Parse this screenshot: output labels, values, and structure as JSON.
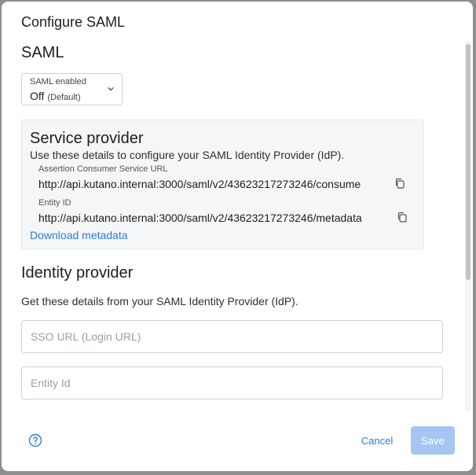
{
  "dialog": {
    "title": "Configure SAML"
  },
  "saml": {
    "section_title": "SAML",
    "enabled_label": "SAML enabled",
    "enabled_value": "Off",
    "enabled_hint": "(Default)"
  },
  "service_provider": {
    "title": "Service provider",
    "description": "Use these details to configure your SAML Identity Provider (IdP).",
    "acs_label": "Assertion Consumer Service URL",
    "acs_value": "http://api.kutano.internal:3000/saml/v2/43623217273246/consume",
    "entity_label": "Entity ID",
    "entity_value": "http://api.kutano.internal:3000/saml/v2/43623217273246/metadata",
    "download_link": "Download metadata"
  },
  "identity_provider": {
    "title": "Identity provider",
    "description": "Get these details from your SAML Identity Provider (IdP).",
    "sso_placeholder": "SSO URL (Login URL)",
    "sso_value": "",
    "entity_placeholder": "Entity Id",
    "entity_value": ""
  },
  "footer": {
    "cancel_label": "Cancel",
    "save_label": "Save"
  },
  "colors": {
    "accent": "#2f7bd9",
    "save_disabled": "#a6c6f2",
    "panel_bg": "#f5f6f7"
  },
  "icons": [
    "chevron-down-icon",
    "copy-icon",
    "help-circle-icon"
  ]
}
